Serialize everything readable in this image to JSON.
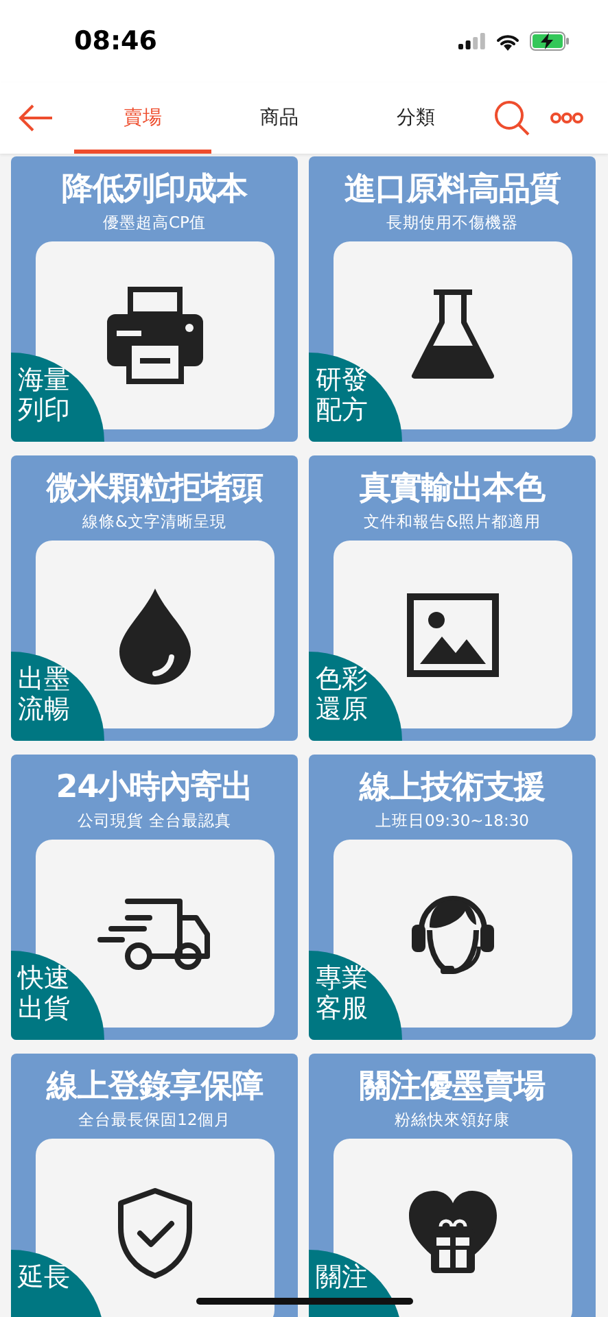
{
  "status_bar": {
    "time": "08:46"
  },
  "nav": {
    "tabs": [
      {
        "label": "賣場",
        "selected": true
      },
      {
        "label": "商品",
        "selected": false
      },
      {
        "label": "分類",
        "selected": false
      }
    ]
  },
  "tiles": [
    {
      "title": "降低列印成本",
      "subtitle": "優墨超高CP值",
      "badge": [
        "海量",
        "列印"
      ],
      "kind": "printer"
    },
    {
      "title": "進口原料高品質",
      "subtitle": "長期使用不傷機器",
      "badge": [
        "研發",
        "配方"
      ],
      "kind": "flask"
    },
    {
      "title": "微米顆粒拒堵頭",
      "subtitle": "線條&文字清晰呈現",
      "badge": [
        "出墨",
        "流暢"
      ],
      "kind": "drop"
    },
    {
      "title": "真實輸出本色",
      "subtitle": "文件和報告&照片都適用",
      "badge": [
        "色彩",
        "還原"
      ],
      "kind": "image"
    },
    {
      "title": "24小時內寄出",
      "subtitle": "公司現貨 全台最認真",
      "badge": [
        "快速",
        "出貨"
      ],
      "kind": "truck"
    },
    {
      "title": "線上技術支援",
      "subtitle": "上班日09:30~18:30",
      "badge": [
        "專業",
        "客服"
      ],
      "kind": "headset"
    },
    {
      "title": "線上登錄享保障",
      "subtitle": "全台最長保固12個月",
      "badge": [
        "延長"
      ],
      "kind": "shield"
    },
    {
      "title": "關注優墨賣場",
      "subtitle": "粉絲快來領好康",
      "badge": [
        "關注"
      ],
      "kind": "gift"
    }
  ]
}
